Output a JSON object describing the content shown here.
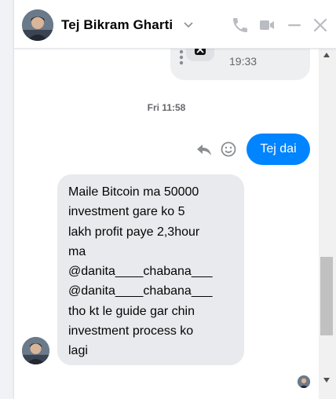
{
  "header": {
    "contact_name": "Tej Bikram Gharti",
    "icons": [
      "chevron-down-icon",
      "phone-icon",
      "video-icon",
      "minimize-icon",
      "close-icon"
    ]
  },
  "previous_message": {
    "time": "19:33"
  },
  "day_separator": "Fri 11:58",
  "outgoing_message": {
    "text": "Tej dai"
  },
  "message_actions": [
    "more-options-icon",
    "reply-icon",
    "react-emoji-icon"
  ],
  "incoming_message": {
    "lines": [
      "Maile Bitcoin ma 50000",
      "investment gare ko 5",
      "lakh profit paye 2,3hour",
      "ma",
      "@danita____chabana___",
      "@danita____chabana___",
      "tho kt le guide gar chin",
      "investment process ko",
      "lagi"
    ]
  },
  "colors": {
    "outgoing_bubble": "#0084ff",
    "incoming_bubble": "#e9eaed",
    "icon_blue": "#0084ff",
    "muted_text": "#65676b"
  }
}
